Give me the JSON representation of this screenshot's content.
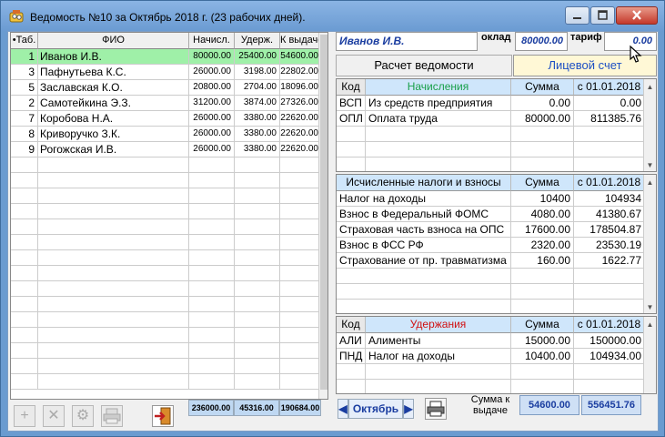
{
  "window": {
    "title": "Ведомость №10 за Октябрь 2018 г. (23 рабочих дней)."
  },
  "grid": {
    "columns": [
      "•Таб.",
      "ФИО",
      "Начисл.",
      "Удерж.",
      "К выдаче"
    ],
    "rows": [
      {
        "tab": "1",
        "fio": "Иванов И.В.",
        "nach": "80000.00",
        "uder": "25400.00",
        "vyd": "54600.00"
      },
      {
        "tab": "3",
        "fio": "Пафнутьева К.С.",
        "nach": "26000.00",
        "uder": "3198.00",
        "vyd": "22802.00"
      },
      {
        "tab": "5",
        "fio": "Заславская К.О.",
        "nach": "20800.00",
        "uder": "2704.00",
        "vyd": "18096.00"
      },
      {
        "tab": "2",
        "fio": "Самотейкина Э.З.",
        "nach": "31200.00",
        "uder": "3874.00",
        "vyd": "27326.00"
      },
      {
        "tab": "7",
        "fio": "Коробова Н.А.",
        "nach": "26000.00",
        "uder": "3380.00",
        "vyd": "22620.00"
      },
      {
        "tab": "8",
        "fio": "Криворучко З.К.",
        "nach": "26000.00",
        "uder": "3380.00",
        "vyd": "22620.00"
      },
      {
        "tab": "9",
        "fio": "Рогожская И.В.",
        "nach": "26000.00",
        "uder": "3380.00",
        "vyd": "22620.00"
      }
    ],
    "totals": {
      "nach": "236000.00",
      "uder": "45316.00",
      "vyd": "190684.00"
    }
  },
  "employee": {
    "name": "Иванов И.В.",
    "oklad_label": "оклад",
    "oklad": "80000.00",
    "tarif_label": "тариф",
    "tarif": "0.00"
  },
  "buttons": {
    "calc": "Расчет ведомости",
    "ls": "Лицевой счет"
  },
  "accruals": {
    "columns": [
      "Код",
      "Начисления",
      "Сумма",
      "с 01.01.2018"
    ],
    "rows": [
      {
        "code": "ВСП",
        "name": "Из средств предприятия",
        "sum": "0.00",
        "ytd": "0.00"
      },
      {
        "code": "ОПЛ",
        "name": "Оплата труда",
        "sum": "80000.00",
        "ytd": "811385.76"
      }
    ]
  },
  "taxes": {
    "columns": [
      "Исчисленные налоги и взносы",
      "Сумма",
      "с 01.01.2018"
    ],
    "rows": [
      {
        "name": "Налог на доходы",
        "sum": "10400",
        "ytd": "104934"
      },
      {
        "name": "Взнос в Федеральный ФОМС",
        "sum": "4080.00",
        "ytd": "41380.67"
      },
      {
        "name": "Страховая часть взноса на ОПС",
        "sum": "17600.00",
        "ytd": "178504.87"
      },
      {
        "name": "Взнос в ФСС РФ",
        "sum": "2320.00",
        "ytd": "23530.19"
      },
      {
        "name": "Страхование от пр. травматизма",
        "sum": "160.00",
        "ytd": "1622.77"
      }
    ]
  },
  "deductions": {
    "columns": [
      "Код",
      "Удержания",
      "Сумма",
      "с 01.01.2018"
    ],
    "rows": [
      {
        "code": "АЛИ",
        "name": "Алименты",
        "sum": "15000.00",
        "ytd": "150000.00"
      },
      {
        "code": "ПНД",
        "name": "Налог на доходы",
        "sum": "10400.00",
        "ytd": "104934.00"
      }
    ]
  },
  "footer": {
    "month": "Октябрь",
    "total_label": "Сумма к выдаче",
    "total": "54600.00",
    "total_ytd": "556451.76"
  },
  "colors": {
    "selected_row": "#9ff0a8",
    "accent_blue": "#1a3da0",
    "accruals_header": "#1aa04a",
    "deductions_header": "#d01010"
  }
}
